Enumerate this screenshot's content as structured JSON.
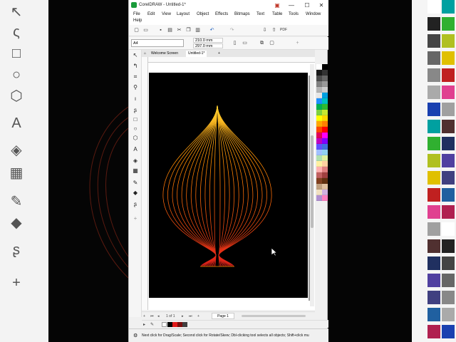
{
  "window": {
    "title": "CorelDRAW - Untitled-1*",
    "controls": [
      "—",
      "☐",
      "✕"
    ]
  },
  "menubar": {
    "items": [
      "File",
      "Edit",
      "View",
      "Layout",
      "Object",
      "Effects",
      "Bitmaps",
      "Text",
      "Table",
      "Tools",
      "Window",
      "Help"
    ]
  },
  "toolbar": {
    "icons": [
      "new-document-icon",
      "open-icon",
      "save-icon",
      "print-icon",
      "cut-icon",
      "copy-icon",
      "paste-icon",
      "undo-icon",
      "redo-icon",
      "import-icon",
      "export-icon",
      "publish-pdf-icon"
    ]
  },
  "property_bar": {
    "page_size": "A4",
    "width": "210.0 mm",
    "height": "297.0 mm"
  },
  "tabs": {
    "welcome": "Welcome Screen",
    "document": "Untitled-1*"
  },
  "page_nav": {
    "page_counter": "1 of 1",
    "page_tab": "Page 1"
  },
  "status_bar": {
    "message": "Next click for Drag/Scale; Second click for Rotate/Skew; Dbl-clicking tool selects all objects; Shift+click mu"
  },
  "artwork": {
    "description_colors": {
      "start": "#ff8c00",
      "end": "#e0201a",
      "tip": "#ffd030"
    },
    "stroke_count": 12
  },
  "palette_colors": [
    "#ffffff",
    "#000000",
    "#1a1a1a",
    "#333333",
    "#4d4d4d",
    "#666666",
    "#808080",
    "#999999",
    "#b3b3b3",
    "#cccccc",
    "#e6e6e6",
    "#00a0e0",
    "#1e90ff",
    "#00c0c0",
    "#00b050",
    "#2fb82f",
    "#7fd13f",
    "#c8e830",
    "#ffff00",
    "#ffd700",
    "#ffa500",
    "#ff8000",
    "#ff4500",
    "#ff0000",
    "#e0005a",
    "#ff00ff",
    "#c000c0",
    "#8000ff",
    "#6050ff",
    "#4070e0",
    "#a0c0ff",
    "#90d0f0",
    "#b0e0b0",
    "#e0f0a0",
    "#fff0a0",
    "#ffd0a0",
    "#ffb0b0",
    "#e08080",
    "#c06060",
    "#a04040",
    "#804020",
    "#603010",
    "#c0a080",
    "#e0c0a0",
    "#f0e0c0",
    "#d0b0e0",
    "#b090d0",
    "#ff80c0"
  ]
}
